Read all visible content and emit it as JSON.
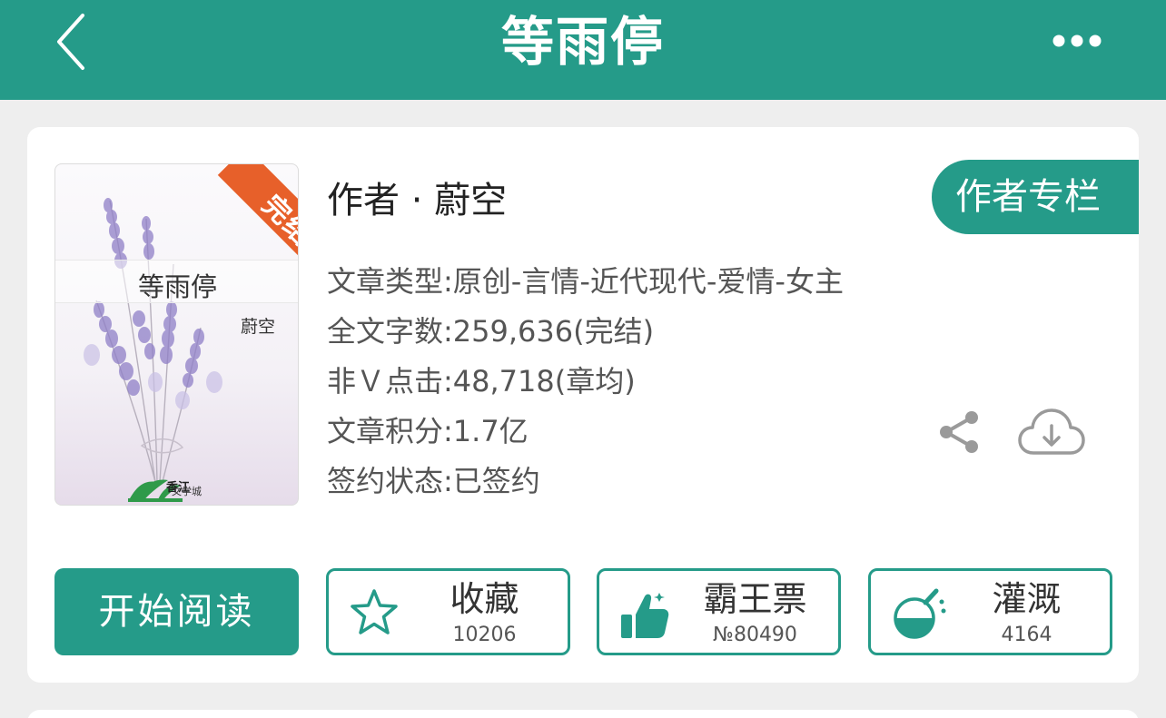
{
  "header": {
    "title": "等雨停"
  },
  "book": {
    "cover_title": "等雨停",
    "cover_author": "蔚空",
    "status_ribbon": "完结",
    "publisher_logo_text": "文学城",
    "author_line": "作者 · 蔚空",
    "author_column_label": "作者专栏",
    "info": [
      "文章类型:原创-言情-近代现代-爱情-女主",
      "全文字数:259,636(完结)",
      "非Ｖ点击:48,718(章均)",
      "文章积分:1.7亿",
      "签约状态:已签约"
    ]
  },
  "actions": {
    "read_label": "开始阅读",
    "favorite": {
      "label": "收藏",
      "count": "10206"
    },
    "ticket": {
      "label": "霸王票",
      "count": "№80490"
    },
    "nutrient": {
      "label": "灌溉",
      "count": "4164"
    }
  },
  "colors": {
    "brand": "#259b89",
    "ribbon": "#e7602a"
  }
}
